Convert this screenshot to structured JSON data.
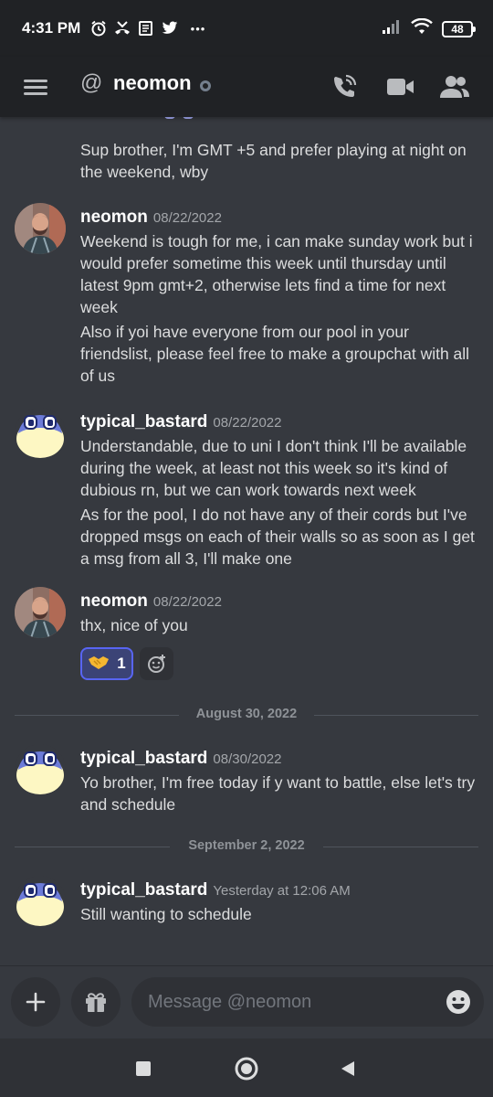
{
  "status_bar": {
    "time": "4:31 PM",
    "left_icons": [
      "alarm-icon",
      "missed-call-icon",
      "news-icon",
      "twitter-icon",
      "more-dots-icon"
    ],
    "more": "•••",
    "battery": "48"
  },
  "header": {
    "at_symbol": "@",
    "title": "neomon",
    "icons": [
      "menu-icon",
      "call-icon",
      "video-icon",
      "members-icon"
    ]
  },
  "messages": [
    {
      "continuation": true,
      "text": [
        "Sup brother, I'm GMT +5 and prefer playing at night on the weekend, wby"
      ]
    },
    {
      "author": "neomon",
      "timestamp": "08/22/2022",
      "avatar": "photo",
      "text": [
        "Weekend is tough for me, i can make sunday work but i would prefer sometime this week until thursday until latest 9pm gmt+2, otherwise lets find a time for next week",
        "Also if yoi have everyone from our pool in your friendslist, please feel free to make a groupchat with all of us"
      ]
    },
    {
      "author": "typical_bastard",
      "timestamp": "08/22/2022",
      "avatar": "creature",
      "text": [
        "Understandable, due to uni I don't think I'll be available during the week, at least not this week so it's kind of dubious rn, but we can work towards next week",
        "As for the pool, I do not have any of their cords but I've dropped msgs on each of their walls so as soon as I get a msg from all 3, I'll make one"
      ]
    },
    {
      "author": "neomon",
      "timestamp": "08/22/2022",
      "avatar": "photo",
      "text": [
        "thx, nice of you"
      ],
      "reaction": {
        "emoji": "handshake-icon",
        "count": "1"
      }
    },
    {
      "author": "typical_bastard",
      "timestamp": "08/30/2022",
      "avatar": "creature",
      "text": [
        "Yo brother, I'm free today if y want to battle, else let's try and schedule"
      ]
    },
    {
      "author": "typical_bastard",
      "timestamp": "Yesterday at 12:06 AM",
      "avatar": "creature",
      "text": [
        "Still wanting to schedule"
      ]
    }
  ],
  "dividers": [
    "August 30, 2022",
    "September 2, 2022"
  ],
  "composer": {
    "placeholder": "Message @neomon",
    "icons": [
      "plus-icon",
      "gift-icon",
      "emoji-icon"
    ]
  },
  "nav_bar": {
    "icons": [
      "recents-square-icon",
      "home-circle-icon",
      "back-triangle-icon"
    ]
  },
  "colors": {
    "background": "#36393f",
    "header": "#202225",
    "accent": "#5865f2",
    "text": "#dcddde",
    "muted": "#a3a6aa"
  }
}
